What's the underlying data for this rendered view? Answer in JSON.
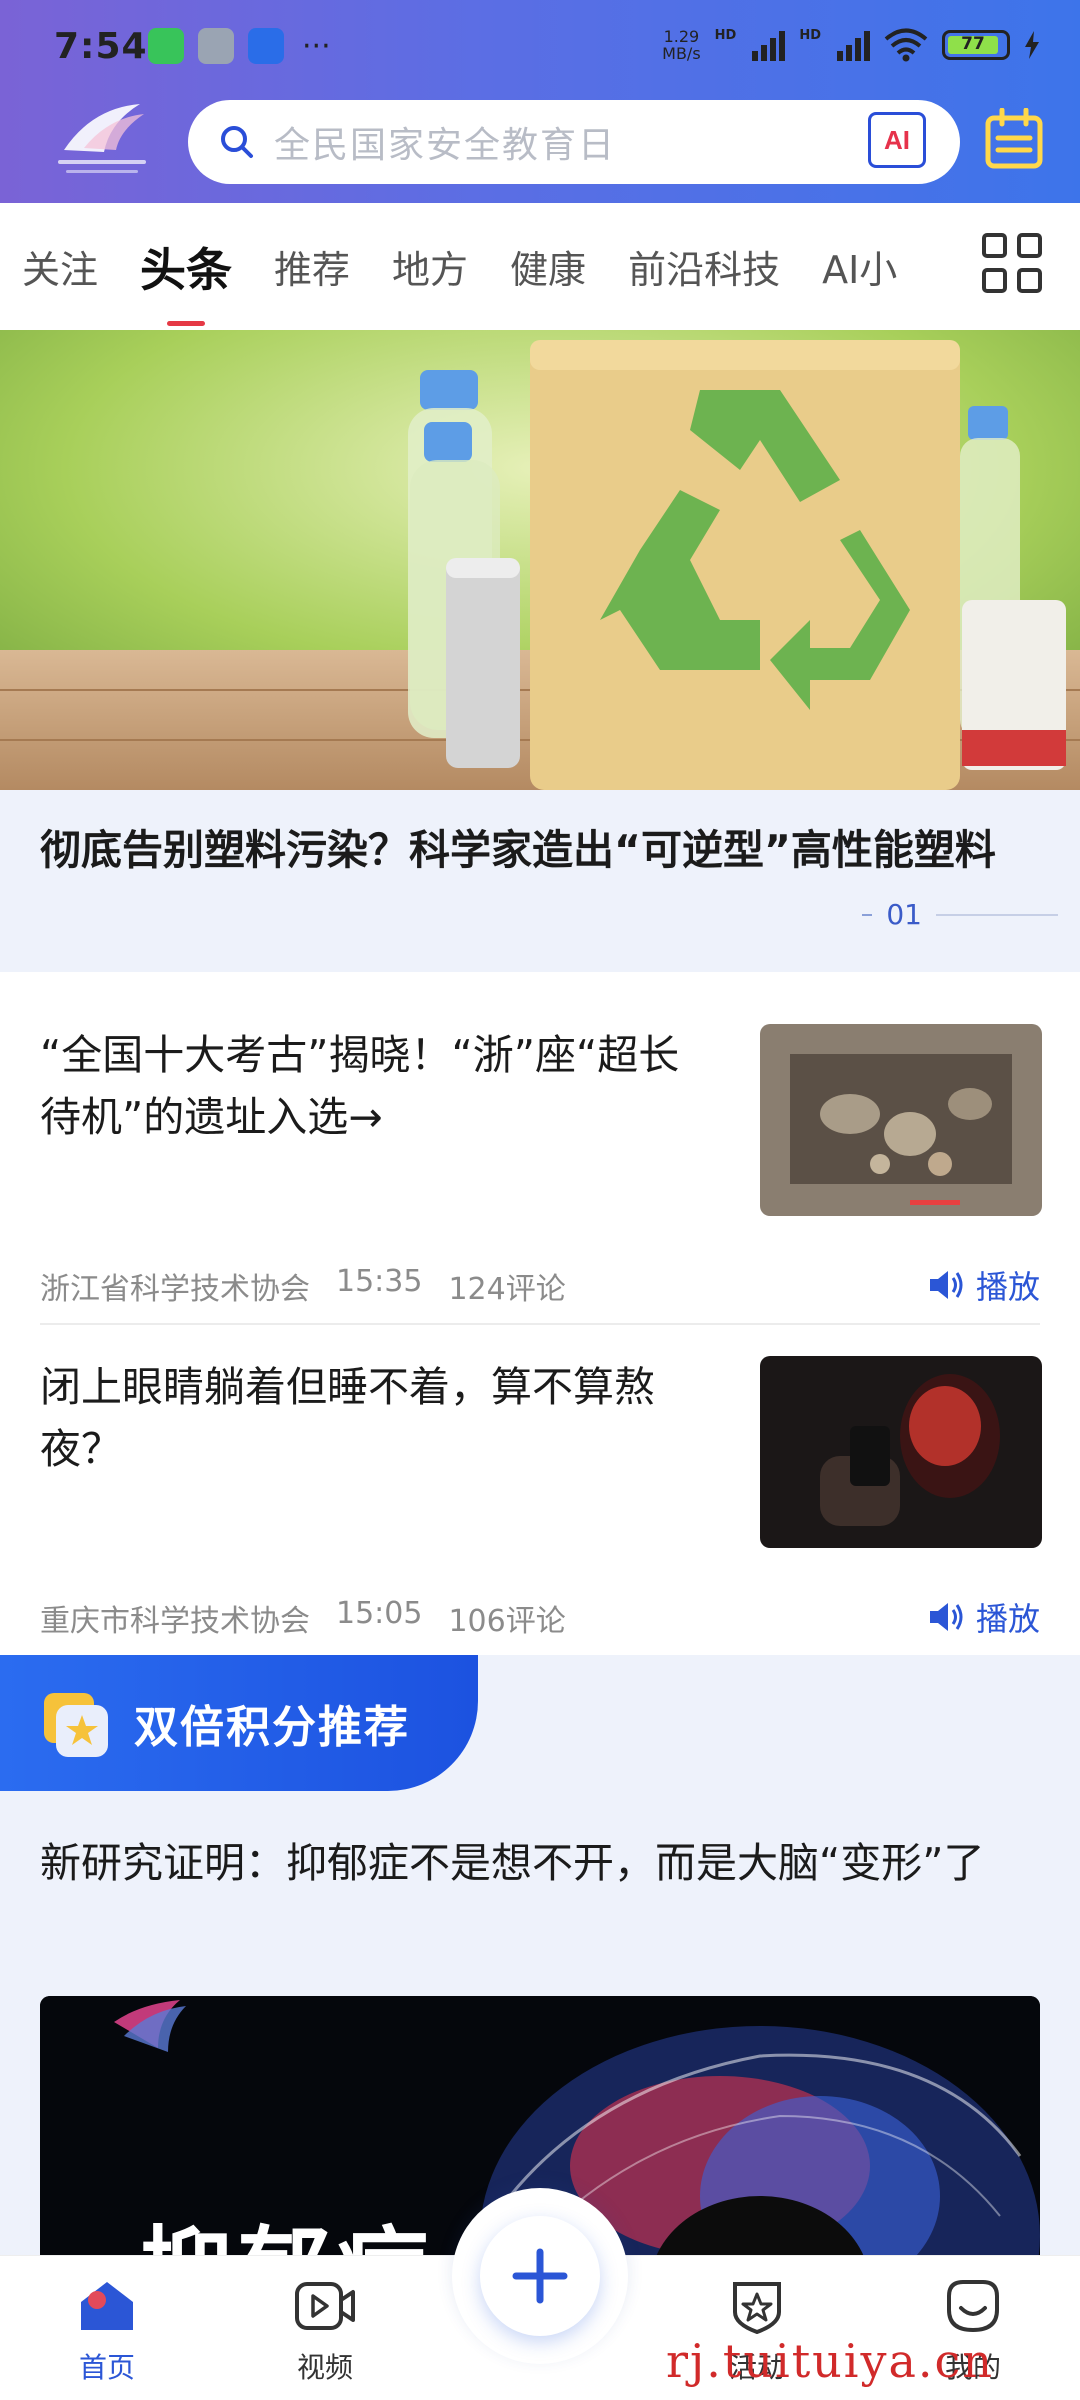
{
  "status_bar": {
    "time": "7:54",
    "net_speed_value": "1.29",
    "net_speed_unit": "MB/s",
    "signal_label": "HD",
    "battery_level": "77",
    "overflow": "···"
  },
  "header": {
    "search_placeholder": "全民国家安全教育日",
    "ai_label": "AI",
    "brand_color": "#3d74ea"
  },
  "tabs": {
    "items": [
      {
        "label": "关注"
      },
      {
        "label": "头条"
      },
      {
        "label": "推荐"
      },
      {
        "label": "地方"
      },
      {
        "label": "健康"
      },
      {
        "label": "前沿科技"
      },
      {
        "label": "AI小"
      }
    ],
    "active_index": 1
  },
  "hero": {
    "title": "彻底告别塑料污染？科学家造出“可逆型”高性能塑料",
    "page": "01"
  },
  "news": [
    {
      "title": "“全国十大考古”揭晓！“浙”座“超长待机”的遗址入选→",
      "source": "浙江省科学技术协会",
      "time": "15:35",
      "comments": "124评论",
      "play_label": "播放"
    },
    {
      "title": "闭上眼睛躺着但睡不着，算不算熬夜？",
      "source": "重庆市科学技术协会",
      "time": "15:05",
      "comments": "106评论",
      "play_label": "播放"
    }
  ],
  "points_section": {
    "badge": "双倍积分推荐",
    "title": "新研究证明：抑郁症不是想不开，而是大脑“变形”了",
    "image_text": "抑郁症"
  },
  "bottom_nav": {
    "items": [
      {
        "label": "首页",
        "icon": "home-icon"
      },
      {
        "label": "视频",
        "icon": "video-icon"
      },
      {
        "label": "活动",
        "icon": "activity-icon"
      },
      {
        "label": "我的",
        "icon": "profile-icon"
      }
    ],
    "active_index": 0
  },
  "watermark": "rj.tuituiya.cn"
}
